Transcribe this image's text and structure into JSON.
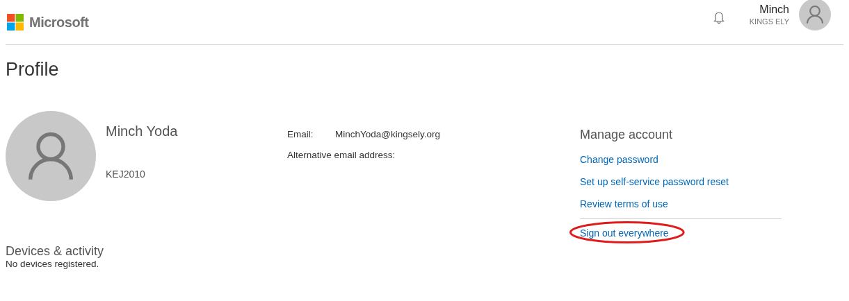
{
  "header": {
    "brand": "Microsoft",
    "user": {
      "name": "Minch",
      "organization": "KINGS ELY"
    }
  },
  "page_title": "Profile",
  "profile": {
    "display_name": "Minch Yoda",
    "user_id": "KEJ2010"
  },
  "contact": [
    {
      "label": "Email:",
      "value": "MinchYoda@kingsely.org"
    },
    {
      "label": "Alternative email address:"
    }
  ],
  "manage_account": {
    "title": "Manage account",
    "links": [
      {
        "label": "Change password",
        "highlighted": false,
        "divider_before": false
      },
      {
        "label": "Set up self-service password reset",
        "highlighted": false,
        "divider_before": false
      },
      {
        "label": "Review terms of use",
        "highlighted": false,
        "divider_before": false
      },
      {
        "label": "Sign out everywhere",
        "highlighted": true,
        "divider_before": true
      }
    ]
  },
  "devices": {
    "title": "Devices & activity",
    "message": "No devices registered."
  }
}
